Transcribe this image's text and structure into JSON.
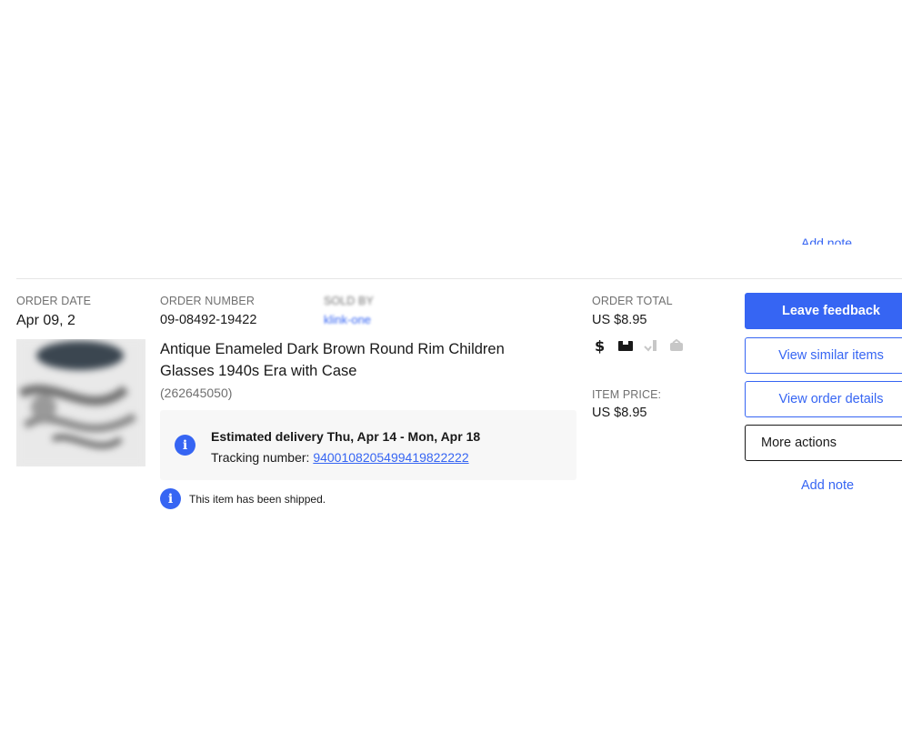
{
  "previous_card": {
    "add_note_label": "Add note"
  },
  "order": {
    "date_label": "ORDER DATE",
    "date_value": "Apr 09, 2",
    "number_label": "ORDER NUMBER",
    "number_value": "09-08492-19422",
    "sold_by_label": "SOLD BY",
    "seller_name": "klink-one",
    "total_label": "ORDER TOTAL",
    "total_value": "US $8.95"
  },
  "item": {
    "title": "Antique Enameled Dark Brown Round Rim Children Glasses 1940s Era with Case",
    "item_number": "(262645050)",
    "price_label": "ITEM PRICE:",
    "price_value": "US $8.95",
    "status_icons": [
      "dollar-paid-icon",
      "package-shipped-icon",
      "delivered-icon",
      "feedback-icon"
    ]
  },
  "delivery": {
    "estimate_text": "Estimated delivery Thu, Apr 14 - Mon, Apr 18",
    "tracking_label": "Tracking number: ",
    "tracking_number": "9400108205499419822222"
  },
  "shipment_status": {
    "text": "This item has been shipped."
  },
  "actions": {
    "leave_feedback": "Leave feedback",
    "view_similar": "View similar items",
    "view_order_details": "View order details",
    "more_actions": "More actions",
    "add_note": "Add note"
  },
  "colors": {
    "accent": "#3665f3",
    "text": "#191919",
    "muted": "#707070",
    "panel": "#f7f7f7"
  }
}
